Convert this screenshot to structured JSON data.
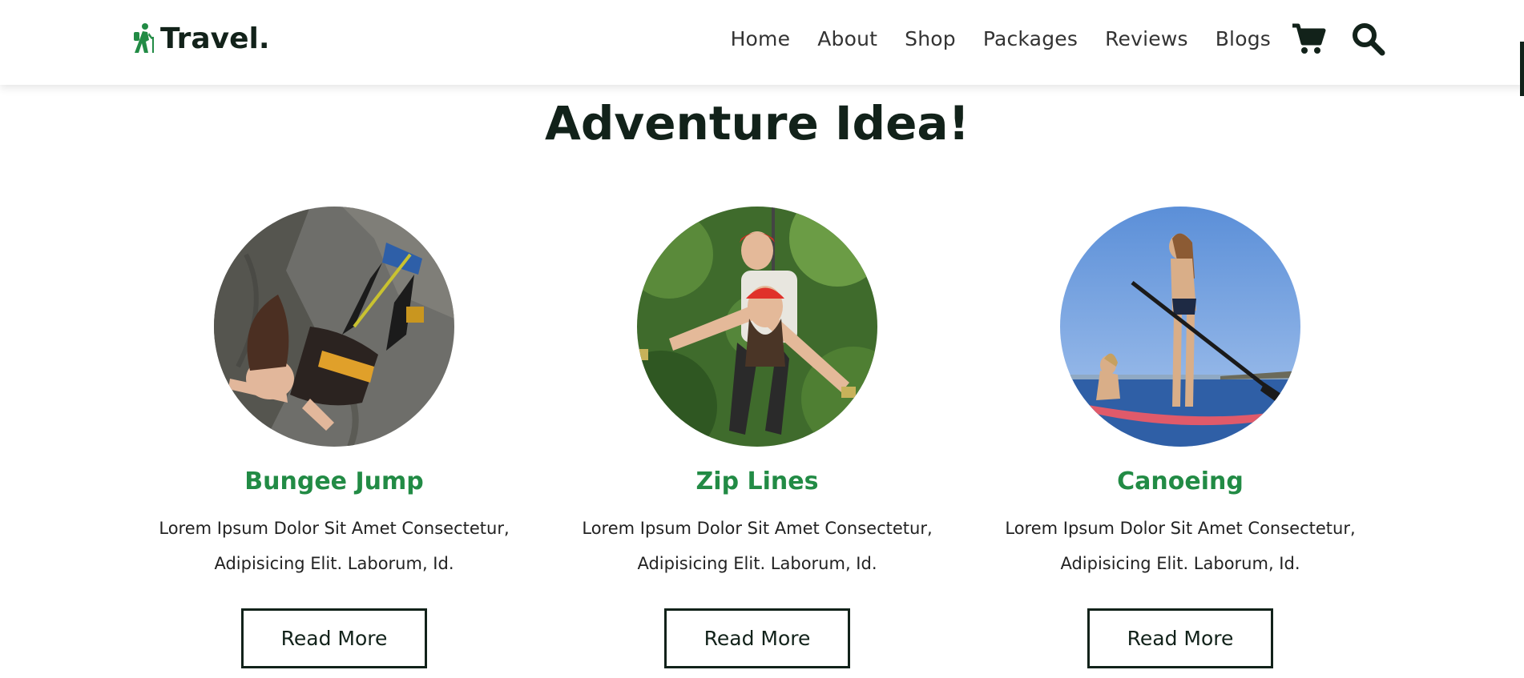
{
  "brand": {
    "name": "Travel.",
    "icon": "hiker-icon",
    "accent": "#228b45"
  },
  "nav": {
    "items": [
      "Home",
      "About",
      "Shop",
      "Packages",
      "Reviews",
      "Blogs"
    ]
  },
  "header_icons": [
    "cart-icon",
    "search-icon"
  ],
  "section": {
    "title": "Adventure Idea!"
  },
  "cards": [
    {
      "title": "Bungee Jump",
      "description": "Lorem Ipsum Dolor Sit Amet Consectetur, Adipisicing Elit. Laborum, Id.",
      "button": "Read More"
    },
    {
      "title": "Zip Lines",
      "description": "Lorem Ipsum Dolor Sit Amet Consectetur, Adipisicing Elit. Laborum, Id.",
      "button": "Read More"
    },
    {
      "title": "Canoeing",
      "description": "Lorem Ipsum Dolor Sit Amet Consectetur, Adipisicing Elit. Laborum, Id.",
      "button": "Read More"
    }
  ],
  "colors": {
    "text_dark": "#12221a",
    "accent": "#228b45"
  }
}
